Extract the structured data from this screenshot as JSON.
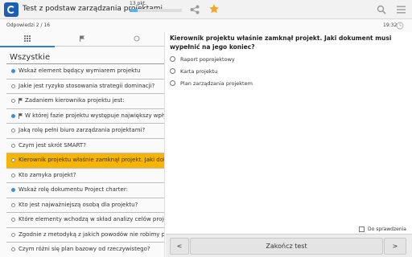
{
  "header": {
    "title": "Test z podstaw zarządzania projektami",
    "progress_label": "13 pkt.",
    "progress_fraction": 0.15
  },
  "status": {
    "answers": "Odpowiedzi  2 / 16",
    "time": "19:32"
  },
  "tabs": [
    {
      "icon": "grid-icon",
      "active": true
    },
    {
      "icon": "flag-icon",
      "active": false
    },
    {
      "icon": "radio-icon",
      "active": false
    }
  ],
  "sidebar": {
    "section_title": "Wszystkie",
    "items": [
      {
        "text": "Wskaż element będący wymiarem projektu",
        "answered": true,
        "flagged": false,
        "selected": false
      },
      {
        "text": "Jakie jest ryzyko stosowania strategii dominacji?",
        "answered": false,
        "flagged": false,
        "selected": false
      },
      {
        "text": "Zadaniem kierownika projektu jest:",
        "answered": false,
        "flagged": true,
        "selected": false
      },
      {
        "text": "W której fazie projektu występuje największy wpływ",
        "answered": true,
        "flagged": true,
        "selected": false
      },
      {
        "text": "Jaką rolę pełni biuro zarządzania projektami?",
        "answered": false,
        "flagged": false,
        "selected": false
      },
      {
        "text": "Czym jest skrót SMART?",
        "answered": false,
        "flagged": false,
        "selected": false
      },
      {
        "text": "Kierownik projektu właśnie zamknął projekt. Jaki doku",
        "answered": false,
        "flagged": false,
        "selected": true
      },
      {
        "text": "Kto zamyka projekt?",
        "answered": false,
        "flagged": false,
        "selected": false
      },
      {
        "text": "Wskaż rolę dokumentu Project charter:",
        "answered": true,
        "flagged": false,
        "selected": false
      },
      {
        "text": "Kto jest najważniejszą osobą dla projektu?",
        "answered": false,
        "flagged": false,
        "selected": false
      },
      {
        "text": "Które elementy wchodzą w skład analizy celów projektu",
        "answered": false,
        "flagged": false,
        "selected": false
      },
      {
        "text": "Zgodnie z metodyką z jakich powodów nie robimy proje",
        "answered": false,
        "flagged": false,
        "selected": false
      },
      {
        "text": "Czym różni się plan bazowy od rzeczywistego?",
        "answered": false,
        "flagged": false,
        "selected": false
      }
    ]
  },
  "question": {
    "text": "Kierownik projektu właśnie zamknął projekt. Jaki dokument musi wypełnić na jego koniec?",
    "options": [
      "Raport poprojektowy",
      "Karta projektu",
      "Plan zarządzania projektem"
    ],
    "to_review_label": "Do sprawdzenia"
  },
  "bottom": {
    "prev": "<",
    "finish": "Zakończ test",
    "next": ">"
  },
  "colors": {
    "accent": "#2b7fd1",
    "selected": "#f7b500",
    "star": "#f5a623"
  }
}
